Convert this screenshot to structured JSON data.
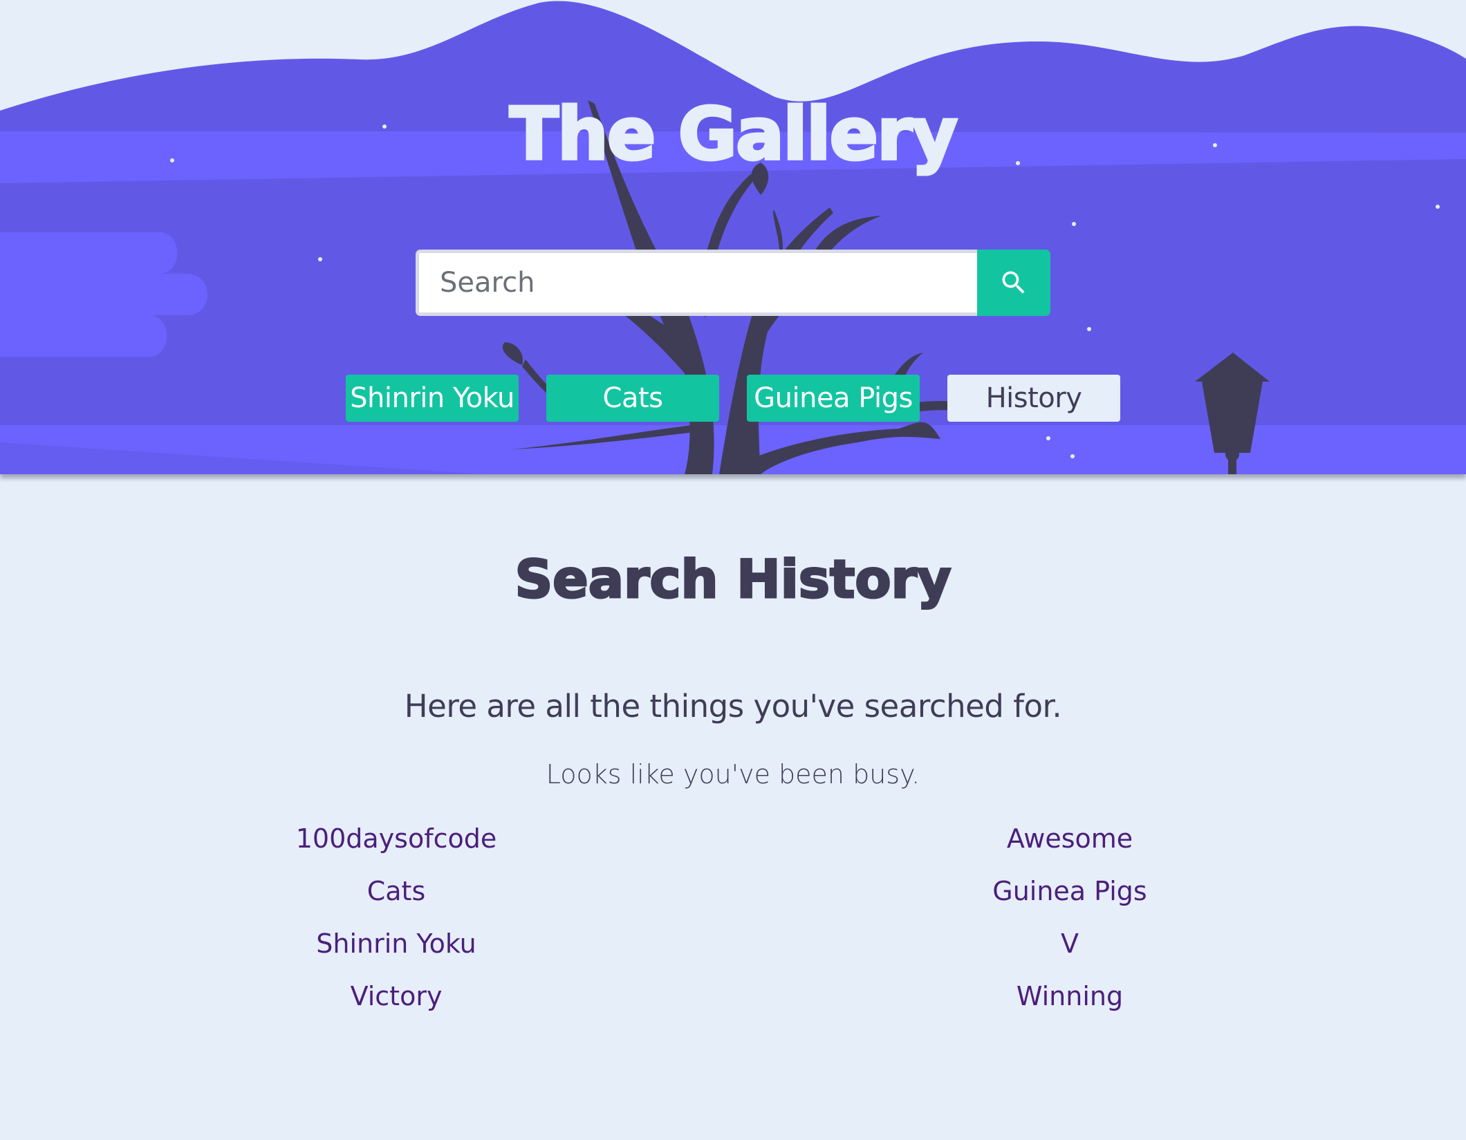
{
  "header": {
    "title": "The Gallery",
    "search": {
      "placeholder": "Search",
      "value": "",
      "button_icon": "search-icon"
    },
    "nav": [
      {
        "label": "Shinrin Yoku",
        "active": false
      },
      {
        "label": "Cats",
        "active": false
      },
      {
        "label": "Guinea Pigs",
        "active": false
      },
      {
        "label": "History",
        "active": true
      }
    ]
  },
  "main": {
    "title": "Search History",
    "lead": "Here are all the things you've searched for.",
    "sublead": "Looks like you've been busy.",
    "history_left": [
      "100daysofcode",
      "Cats",
      "Shinrin Yoku",
      "Victory"
    ],
    "history_right": [
      "Awesome",
      "Guinea Pigs",
      "V",
      "Winning"
    ]
  },
  "colors": {
    "background": "#e6eefa",
    "hero": "#6159e6",
    "hero_band": "#6c63ff",
    "accent": "#13c4a1",
    "dark": "#3f3d56",
    "link": "#4b1f7a"
  }
}
